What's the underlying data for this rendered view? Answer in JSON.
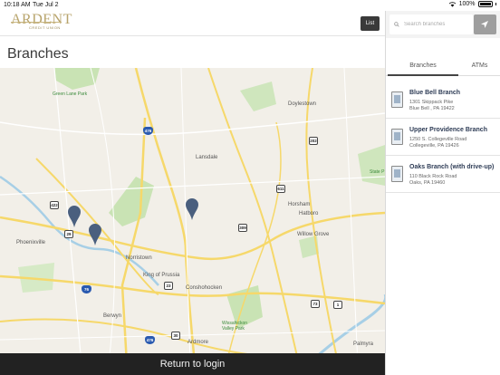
{
  "status_bar": {
    "time": "10:18 AM",
    "date": "Tue Jul 2",
    "battery": "100%"
  },
  "header": {
    "logo_word": "ARDENT",
    "logo_sub": "CREDIT UNION",
    "list_button": "List"
  },
  "page_title": "Branches",
  "map": {
    "labels": {
      "green_lane_park": "Green Lane Park",
      "doylestown": "Doylestown",
      "lansdale": "Lansdale",
      "horsham": "Horsham",
      "hatboro": "Hatboro",
      "willow_grove": "Willow Grove",
      "phoenixville": "Phoenixville",
      "norristown": "Norristown",
      "king_of_prussia": "King of Prussia",
      "conshohocken": "Conshohocken",
      "berwyn": "Berwyn",
      "ardmore": "Ardmore",
      "wissahickon": "Wissahickon Valley Park",
      "palmyra": "Palmyra",
      "state_park": "State P"
    },
    "shields": {
      "i476_north": "476",
      "us202": "202",
      "pa611": "611",
      "us309": "309",
      "pa422": "422",
      "pa29": "29",
      "pa23": "23",
      "i76": "76",
      "i476_south": "476",
      "pa73": "73",
      "pa1": "1",
      "pa30": "30"
    },
    "pins": [
      "Blue Bell Branch",
      "Upper Providence Branch",
      "Oaks Branch (with drive-up)"
    ]
  },
  "return_button": "Return to login",
  "search": {
    "placeholder": "Search branches",
    "value": ""
  },
  "tabs": [
    {
      "label": "Branches",
      "active": true
    },
    {
      "label": "ATMs",
      "active": false
    }
  ],
  "branches": [
    {
      "name": "Blue Bell Branch",
      "address": "1301 Skippack Pike",
      "city": "Blue Bell , PA 19422"
    },
    {
      "name": "Upper Providence Branch",
      "address": "1250 S. Collegeville Road",
      "city": "Collegeville, PA 19426"
    },
    {
      "name": "Oaks Branch (with drive-up)",
      "address": "110 Black Rock Road",
      "city": "Oaks, PA 19460"
    }
  ],
  "colors": {
    "accent": "#b8a46c",
    "pin": "#4a5f7e",
    "map_bg": "#f2efe8",
    "road": "#f6d86a",
    "park": "#bfe0a8",
    "water": "#a7cfe6"
  }
}
